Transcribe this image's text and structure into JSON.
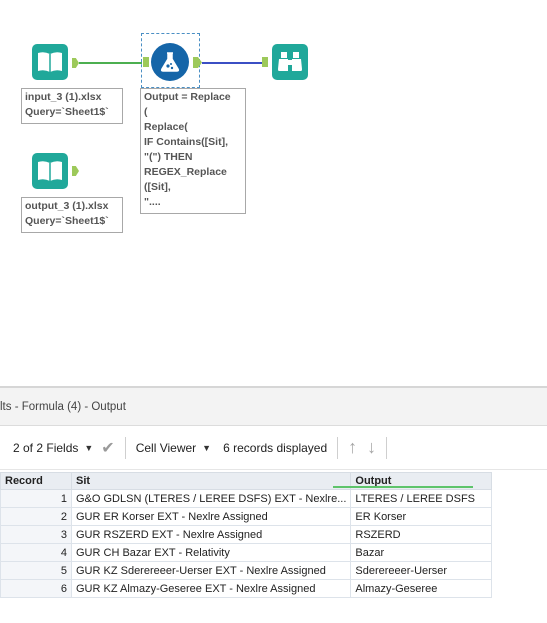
{
  "canvas": {
    "input_annotation": [
      "input_3 (1).xlsx",
      "Query=`Sheet1$`"
    ],
    "output_annotation": [
      "output_3 (1).xlsx",
      "Query=`Sheet1$`"
    ],
    "formula_annotation": [
      "Output = Replace",
      "(",
      "Replace(",
      "IF Contains([Sit],",
      "\"(\") THEN",
      "REGEX_Replace",
      "([Sit],",
      "\"...."
    ],
    "colors": {
      "tool_teal": "#20a89a",
      "formula_blue": "#1565a8",
      "browse_teal": "#20a89a",
      "anchor_green": "#9dc95a",
      "conn_green": "#4caf50",
      "conn_blue": "#3b4fc4"
    },
    "icons": {
      "input": "book-icon",
      "output": "book-icon",
      "formula": "flask-icon",
      "browse": "binoculars-icon"
    }
  },
  "results": {
    "title": "lts - Formula (4) - Output",
    "toolbar": {
      "fields": "2 of 2 Fields",
      "viewer": "Cell Viewer",
      "records": "6 records displayed"
    },
    "columns": [
      "Record",
      "Sit",
      "Output"
    ],
    "rows": [
      [
        "1",
        "G&O GDLSN (LTERES / LEREE DSFS) EXT - Nexlre...",
        "LTERES / LEREE DSFS"
      ],
      [
        "2",
        "GUR ER Korser EXT - Nexlre Assigned",
        "ER Korser"
      ],
      [
        "3",
        "GUR RSZERD EXT - Nexlre Assigned",
        "RSZERD"
      ],
      [
        "4",
        "GUR CH Bazar EXT - Relativity",
        "Bazar"
      ],
      [
        "5",
        "GUR KZ Sderereeer-Uerser EXT - Nexlre Assigned",
        "Sderereeer-Uerser"
      ],
      [
        "6",
        "GUR KZ Almazy-Geseree EXT - Nexlre Assigned",
        "Almazy-Geseree"
      ]
    ]
  }
}
